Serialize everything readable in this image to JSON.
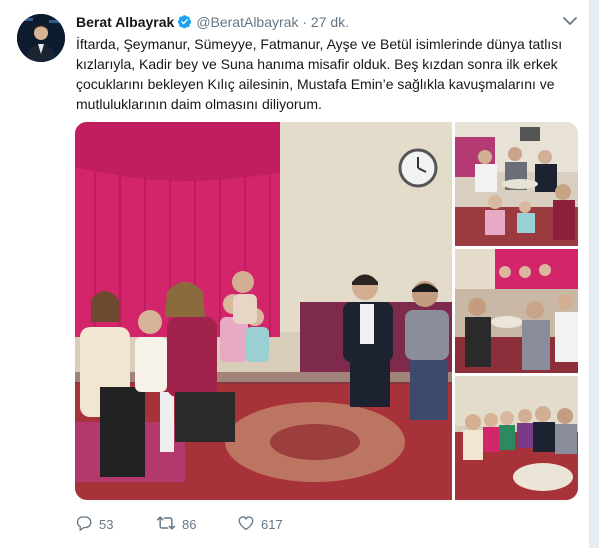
{
  "tweet": {
    "author_name": "Berat Albayrak",
    "handle": "@BeratAlbayrak",
    "separator": "·",
    "time": "27 dk.",
    "text_lines": [
      "İftarda, Şeymanur, Sümeyye, Fatmanur, Ayşe ve Betül isimlerinde dünya tatlısı",
      "kızlarıyla, Kadir bey ve Suna hanıma misafir olduk. Beş kızdan sonra ilk erkek",
      "çocuklarını bekleyen Kılıç ailesinin, Mustafa Emin’e sağlıkla kavuşmalarını ve",
      "mutluluklarının daim olmasını diliyorum."
    ],
    "replies": "53",
    "retweets": "86",
    "likes": "617"
  },
  "icons": {
    "verified": "verified-badge-icon",
    "caret": "chevron-down-icon",
    "reply": "reply-icon",
    "retweet": "retweet-icon",
    "like": "heart-icon"
  },
  "colors": {
    "verified": "#1da1f2",
    "text": "#14171a",
    "secondary": "#657786",
    "curtain": "#d3256a"
  }
}
